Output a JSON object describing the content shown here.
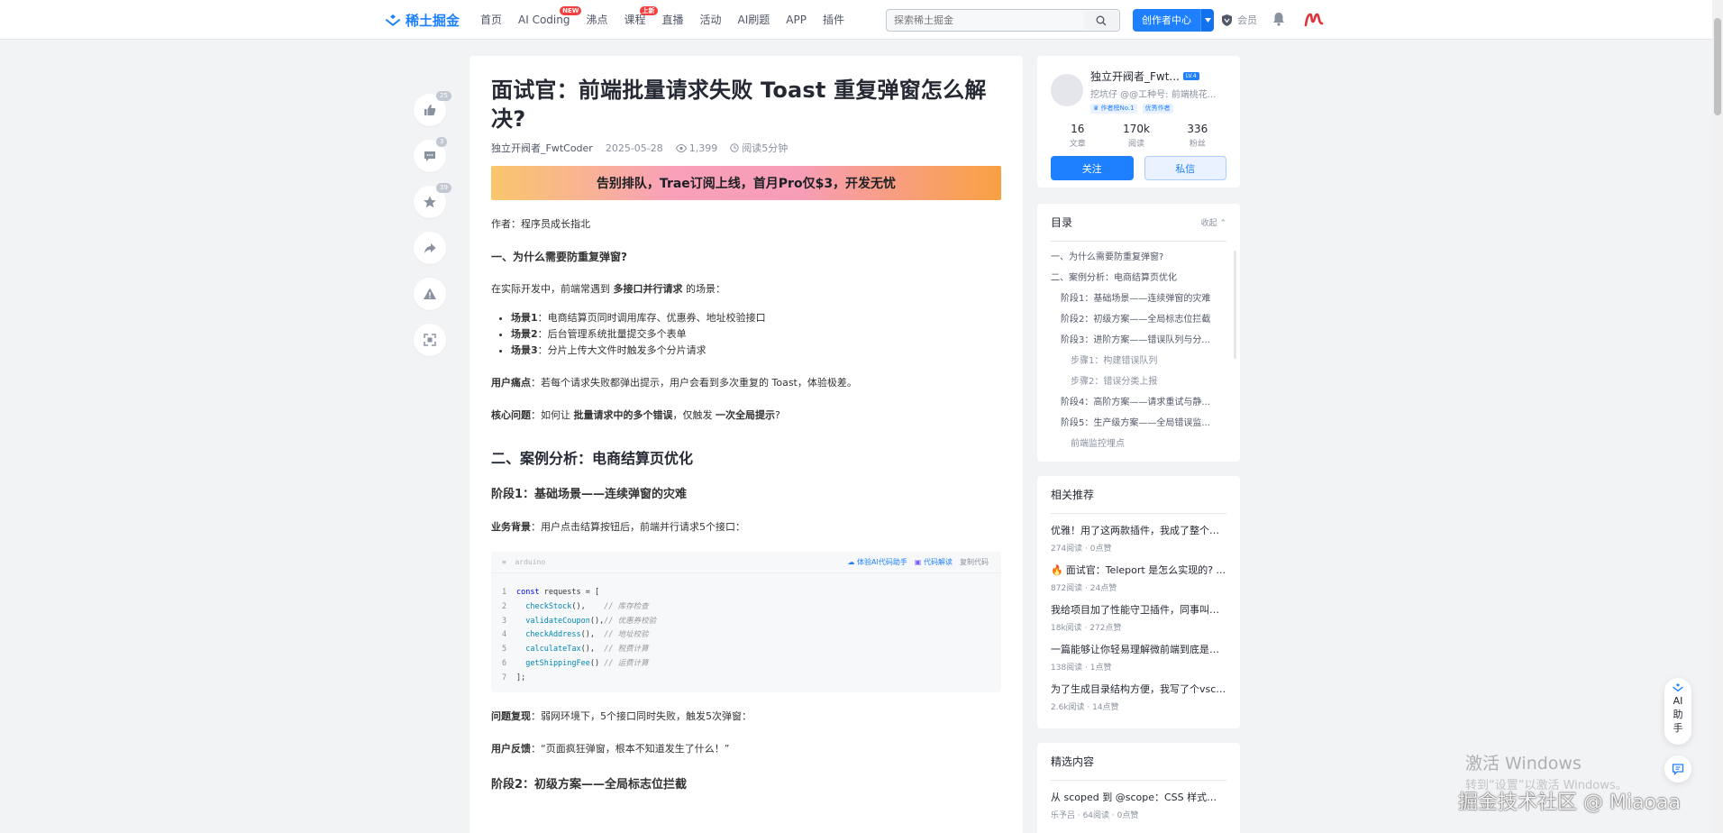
{
  "header": {
    "logo_text": "稀土掘金",
    "nav": [
      {
        "label": "首页",
        "badge": ""
      },
      {
        "label": "AI Coding",
        "badge": "NEW"
      },
      {
        "label": "沸点",
        "badge": ""
      },
      {
        "label": "课程",
        "badge": "上新"
      },
      {
        "label": "直播",
        "badge": ""
      },
      {
        "label": "活动",
        "badge": ""
      },
      {
        "label": "AI刷题",
        "badge": ""
      },
      {
        "label": "APP",
        "badge": ""
      },
      {
        "label": "插件",
        "badge": ""
      }
    ],
    "search_placeholder": "探索稀土掘金",
    "creator_label": "创作者中心",
    "vip_label": "会员"
  },
  "actions": {
    "like_count": "25",
    "comment_count": "3",
    "collect_count": "39"
  },
  "article": {
    "title": "面试官：前端批量请求失败 Toast 重复弹窗怎么解决?",
    "author": "独立开阀者_FwtCoder",
    "date": "2025-05-28",
    "views": "1,399",
    "read_time": "阅读5分钟",
    "banner": "告别排队，Trae订阅上线，首月Pro仅$3，开发无忧",
    "author_line": "作者：程序员成长指北",
    "sec1_heading": "一、为什么需要防重复弹窗?",
    "sec1_intro_pre": "在实际开发中，前端常遇到 ",
    "sec1_intro_bold": "多接口并行请求",
    "sec1_intro_post": " 的场景：",
    "scenes": [
      {
        "label": "场景1",
        "text": "：电商结算页同时调用库存、优惠券、地址校验接口"
      },
      {
        "label": "场景2",
        "text": "：后台管理系统批量提交多个表单"
      },
      {
        "label": "场景3",
        "text": "：分片上传大文件时触发多个分片请求"
      }
    ],
    "pain_label": "用户痛点",
    "pain_text": "：若每个请求失败都弹出提示，用户会看到多次重复的 Toast，体验极差。",
    "core_label": "核心问题",
    "core_pre": "：如何让 ",
    "core_bold1": "批量请求中的多个错误",
    "core_mid": "，仅触发 ",
    "core_bold2": "一次全局提示",
    "core_post": "?",
    "sec2_heading": "二、案例分析：电商结算页优化",
    "stage1_heading": "阶段1：基础场景——连续弹窗的灾难",
    "biz_label": "业务背景",
    "biz_text": "：用户点击结算按钮后，前端并行请求5个接口：",
    "code": {
      "lang": "arduino",
      "tool_ai": "体验AI代码助手",
      "tool_explain": "代码解读",
      "tool_copy": "复制代码",
      "lines": [
        {
          "n": "1",
          "kw": "const",
          "rest": " requests = [",
          "fn": "",
          "comment": ""
        },
        {
          "n": "2",
          "kw": "",
          "rest": "(),    ",
          "fn": "  checkStock",
          "comment": "// 库存检查"
        },
        {
          "n": "3",
          "kw": "",
          "rest": "(),",
          "fn": "  validateCoupon",
          "comment": "// 优惠券校验"
        },
        {
          "n": "4",
          "kw": "",
          "rest": "(),  ",
          "fn": "  checkAddress",
          "comment": "// 地址校验"
        },
        {
          "n": "5",
          "kw": "",
          "rest": "(),  ",
          "fn": "  calculateTax",
          "comment": "// 税费计算"
        },
        {
          "n": "6",
          "kw": "",
          "rest": "() ",
          "fn": "  getShippingFee",
          "comment": "// 运费计算"
        },
        {
          "n": "7",
          "kw": "",
          "rest": "];",
          "fn": "",
          "comment": ""
        }
      ]
    },
    "repro_label": "问题复现",
    "repro_text": "：弱网环境下，5个接口同时失败，触发5次弹窗：",
    "feedback_label": "用户反馈",
    "feedback_text": "：“页面疯狂弹窗，根本不知道发生了什么！”",
    "stage2_heading": "阶段2：初级方案——全局标志位拦截"
  },
  "author_card": {
    "name": "独立开阀者_Fwt...",
    "level": "LV.4",
    "desc": "挖坑仔 @@工种号: 前端桃花...",
    "tag1": "作者榜No.1",
    "tag2": "优秀作者",
    "stats": [
      {
        "num": "16",
        "label": "文章"
      },
      {
        "num": "170k",
        "label": "阅读"
      },
      {
        "num": "336",
        "label": "粉丝"
      }
    ],
    "follow": "关注",
    "message": "私信"
  },
  "toc": {
    "title": "目录",
    "fold": "收起",
    "items": [
      {
        "text": "一、为什么需要防重复弹窗?",
        "level": 1
      },
      {
        "text": "二、案例分析：电商结算页优化",
        "level": 1
      },
      {
        "text": "阶段1：基础场景——连续弹窗的灾难",
        "level": 2
      },
      {
        "text": "阶段2：初级方案——全局标志位拦截",
        "level": 2
      },
      {
        "text": "阶段3：进阶方案——错误队列与分...",
        "level": 2
      },
      {
        "text": "步骤1：构建错误队列",
        "level": 3
      },
      {
        "text": "步骤2：错误分类上报",
        "level": 3
      },
      {
        "text": "阶段4：高阶方案——请求重试与静...",
        "level": 2
      },
      {
        "text": "阶段5：生产级方案——全局错误监...",
        "level": 2
      },
      {
        "text": "前端监控埋点",
        "level": 3
      }
    ]
  },
  "recommend": {
    "title": "相关推荐",
    "items": [
      {
        "title": "优雅！用了这两款插件，我成了整个公...",
        "meta": "274阅读 · 0点赞",
        "hot": false
      },
      {
        "title": "面试官：Teleport 是怎么实现的? ...",
        "meta": "872阅读 · 24点赞",
        "hot": true
      },
      {
        "title": "我给项目加了性能守卫插件，同事叫我...",
        "meta": "18k阅读 · 272点赞",
        "hot": false
      },
      {
        "title": "一篇能够让你轻易理解微前端到底是个...",
        "meta": "138阅读 · 1点赞",
        "hot": false
      },
      {
        "title": "为了生成目录结构方便，我写了个vsco...",
        "meta": "2.6k阅读 · 14点赞",
        "hot": false
      }
    ]
  },
  "selected": {
    "title": "精选内容",
    "items": [
      {
        "title": "从 scoped 到 @scope：CSS 样式隔离...",
        "meta": "乐予吕 · 64阅读 · 0点赞"
      }
    ]
  },
  "float": {
    "ai_label": "AI助手"
  },
  "watermarks": {
    "win_line1": "激活 Windows",
    "win_line2": "转到“设置”以激活 Windows。",
    "site": "掘金技术社区 @ Miaoaa"
  }
}
